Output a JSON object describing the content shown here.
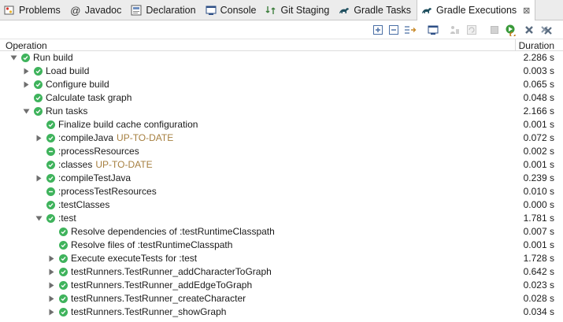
{
  "tabs": [
    {
      "label": "Problems",
      "icon": "problems-icon"
    },
    {
      "label": "Javadoc",
      "icon": "javadoc-icon"
    },
    {
      "label": "Declaration",
      "icon": "declaration-icon"
    },
    {
      "label": "Console",
      "icon": "console-icon"
    },
    {
      "label": "Git Staging",
      "icon": "git-staging-icon"
    },
    {
      "label": "Gradle Tasks",
      "icon": "gradle-icon"
    },
    {
      "label": "Gradle Executions",
      "icon": "gradle-icon",
      "active": true
    }
  ],
  "header": {
    "operation": "Operation",
    "duration": "Duration"
  },
  "rows": [
    {
      "level": 0,
      "expander": "expanded",
      "status": "success",
      "label": "Run build",
      "flag": "",
      "duration": "2.286 s"
    },
    {
      "level": 1,
      "expander": "collapsed",
      "status": "success",
      "label": "Load build",
      "flag": "",
      "duration": "0.003 s"
    },
    {
      "level": 1,
      "expander": "collapsed",
      "status": "success",
      "label": "Configure build",
      "flag": "",
      "duration": "0.065 s"
    },
    {
      "level": 1,
      "expander": "none",
      "status": "success",
      "label": "Calculate task graph",
      "flag": "",
      "duration": "0.048 s"
    },
    {
      "level": 1,
      "expander": "expanded",
      "status": "success",
      "label": "Run tasks",
      "flag": "",
      "duration": "2.166 s"
    },
    {
      "level": 2,
      "expander": "none",
      "status": "success",
      "label": "Finalize build cache configuration",
      "flag": "",
      "duration": "0.001 s"
    },
    {
      "level": 2,
      "expander": "collapsed",
      "status": "success",
      "label": ":compileJava",
      "flag": "UP-TO-DATE",
      "duration": "0.072 s"
    },
    {
      "level": 2,
      "expander": "none",
      "status": "skipped",
      "label": ":processResources",
      "flag": "",
      "duration": "0.002 s"
    },
    {
      "level": 2,
      "expander": "none",
      "status": "success",
      "label": ":classes",
      "flag": "UP-TO-DATE",
      "duration": "0.001 s"
    },
    {
      "level": 2,
      "expander": "collapsed",
      "status": "success",
      "label": ":compileTestJava",
      "flag": "",
      "duration": "0.239 s"
    },
    {
      "level": 2,
      "expander": "none",
      "status": "skipped",
      "label": ":processTestResources",
      "flag": "",
      "duration": "0.010 s"
    },
    {
      "level": 2,
      "expander": "none",
      "status": "success",
      "label": ":testClasses",
      "flag": "",
      "duration": "0.000 s"
    },
    {
      "level": 2,
      "expander": "expanded",
      "status": "success",
      "label": ":test",
      "flag": "",
      "duration": "1.781 s"
    },
    {
      "level": 3,
      "expander": "none",
      "status": "success",
      "label": "Resolve dependencies of :testRuntimeClasspath",
      "flag": "",
      "duration": "0.007 s"
    },
    {
      "level": 3,
      "expander": "none",
      "status": "success",
      "label": "Resolve files of :testRuntimeClasspath",
      "flag": "",
      "duration": "0.001 s"
    },
    {
      "level": 3,
      "expander": "collapsed",
      "status": "success",
      "label": "Execute executeTests for :test",
      "flag": "",
      "duration": "1.728 s"
    },
    {
      "level": 3,
      "expander": "collapsed",
      "status": "success",
      "label": "testRunners.TestRunner_addCharacterToGraph",
      "flag": "",
      "duration": "0.642 s"
    },
    {
      "level": 3,
      "expander": "collapsed",
      "status": "success",
      "label": "testRunners.TestRunner_addEdgeToGraph",
      "flag": "",
      "duration": "0.023 s"
    },
    {
      "level": 3,
      "expander": "collapsed",
      "status": "success",
      "label": "testRunners.TestRunner_createCharacter",
      "flag": "",
      "duration": "0.028 s"
    },
    {
      "level": 3,
      "expander": "collapsed",
      "status": "success",
      "label": "testRunners.TestRunner_showGraph",
      "flag": "",
      "duration": "0.034 s"
    }
  ],
  "toolbar_icons": [
    "expand-all-icon",
    "collapse-all-icon",
    "link-with-selection-icon",
    "show-console-icon",
    "cancel-icon",
    "rerun-failed-icon",
    "stop-icon",
    "rerun-icon",
    "remove-icon",
    "remove-all-icon"
  ],
  "colors": {
    "success": "#3fb35c",
    "flag": "#a67f3f",
    "tabbar": "#ececec"
  }
}
